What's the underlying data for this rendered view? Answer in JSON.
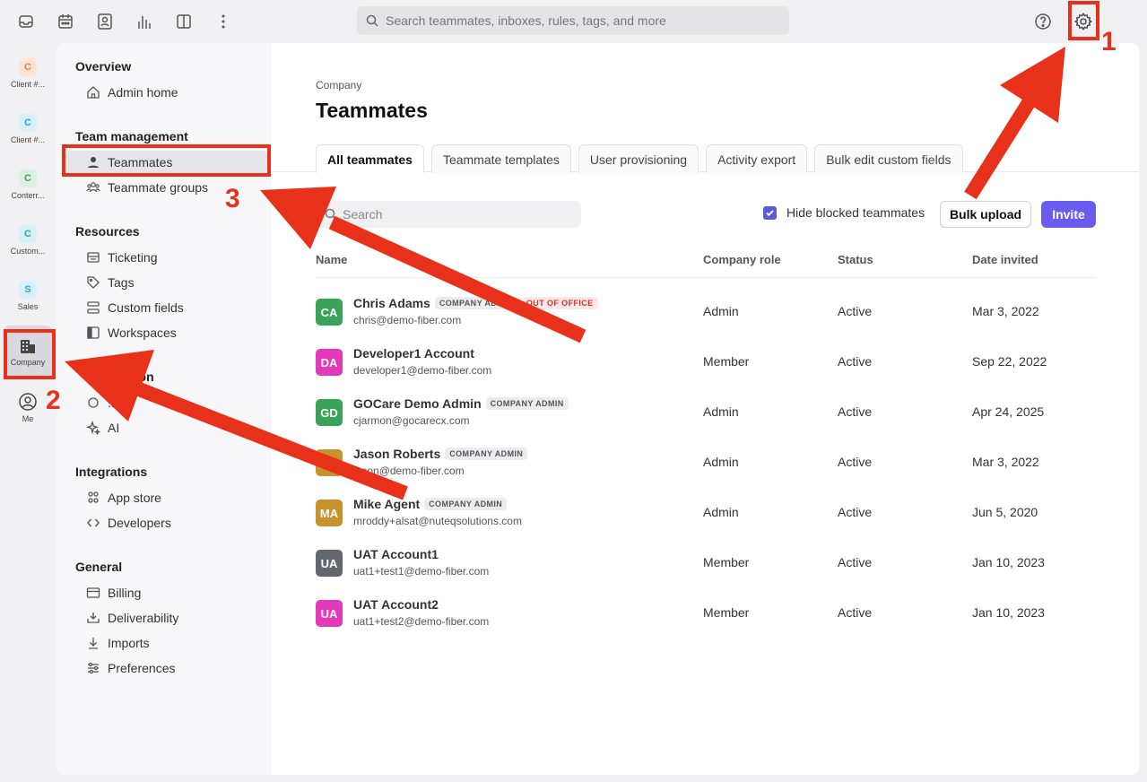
{
  "topbar": {
    "search_placeholder": "Search teammates, inboxes, rules, tags, and more",
    "icons": [
      "inbox-icon",
      "calendar-icon",
      "contacts-icon",
      "analytics-icon",
      "split-view-icon",
      "more-icon",
      "help-icon",
      "settings-gear-icon"
    ]
  },
  "rail": {
    "items": [
      {
        "badge": "C",
        "label": "Client #...",
        "color": "#f07a3a",
        "bg": "#fde5d6"
      },
      {
        "badge": "C",
        "label": "Client #...",
        "color": "#2aa7c9",
        "bg": "#d7f1f8"
      },
      {
        "badge": "C",
        "label": "Conterr...",
        "color": "#3aa35a",
        "bg": "#d9f1de"
      },
      {
        "badge": "C",
        "label": "Custom...",
        "color": "#2aa7c9",
        "bg": "#d7f1f8"
      },
      {
        "badge": "S",
        "label": "Sales",
        "color": "#2aa7c9",
        "bg": "#d7f1f8"
      }
    ],
    "company_label": "Company",
    "me_label": "Me"
  },
  "nav": {
    "overview": {
      "title": "Overview",
      "items": [
        "Admin home"
      ]
    },
    "team": {
      "title": "Team management",
      "items": [
        "Teammates",
        "Teammate groups"
      ]
    },
    "resources": {
      "title": "Resources",
      "items": [
        "Ticketing",
        "Tags",
        "Custom fields",
        "Workspaces"
      ]
    },
    "automation": {
      "title": "...ion",
      "items": [
        "...es",
        "AI"
      ]
    },
    "integrations": {
      "title": "Integrations",
      "items": [
        "App store",
        "Developers"
      ]
    },
    "general": {
      "title": "General",
      "items": [
        "Billing",
        "Deliverability",
        "Imports",
        "Preferences"
      ]
    }
  },
  "main": {
    "breadcrumb": "Company",
    "title": "Teammates",
    "tabs": [
      "All teammates",
      "Teammate templates",
      "User provisioning",
      "Activity export",
      "Bulk edit custom fields"
    ],
    "search_placeholder": "Search",
    "hide_blocked_label": "Hide blocked teammates",
    "bulk_upload_label": "Bulk upload",
    "invite_label": "Invite",
    "columns": [
      "Name",
      "Company role",
      "Status",
      "Date invited"
    ],
    "rows": [
      {
        "initials": "CA",
        "color": "#3aa35a",
        "name": "Chris Adams",
        "chips": [
          "COMPANY ADMIN",
          "OUT OF OFFICE"
        ],
        "email": "chris@demo-fiber.com",
        "role": "Admin",
        "status": "Active",
        "date": "Mar 3, 2022"
      },
      {
        "initials": "DA",
        "color": "#e23ab8",
        "name": "Developer1 Account",
        "chips": [],
        "email": "developer1@demo-fiber.com",
        "role": "Member",
        "status": "Active",
        "date": "Sep 22, 2022"
      },
      {
        "initials": "GD",
        "color": "#3aa35a",
        "name": "GOCare Demo Admin",
        "chips": [
          "COMPANY ADMIN"
        ],
        "email": "cjarmon@gocarecx.com",
        "role": "Admin",
        "status": "Active",
        "date": "Apr 24, 2025"
      },
      {
        "initials": "JR",
        "color": "#c8932e",
        "name": "Jason Roberts",
        "chips": [
          "COMPANY ADMIN"
        ],
        "email": "jason@demo-fiber.com",
        "role": "Admin",
        "status": "Active",
        "date": "Mar 3, 2022"
      },
      {
        "initials": "MA",
        "color": "#c8932e",
        "name": "Mike Agent",
        "chips": [
          "COMPANY ADMIN"
        ],
        "email": "mroddy+alsat@nuteqsolutions.com",
        "role": "Admin",
        "status": "Active",
        "date": "Jun 5, 2020"
      },
      {
        "initials": "UA",
        "color": "#62666f",
        "name": "UAT Account1",
        "chips": [],
        "email": "uat1+test1@demo-fiber.com",
        "role": "Member",
        "status": "Active",
        "date": "Jan 10, 2023"
      },
      {
        "initials": "UA",
        "color": "#e23ab8",
        "name": "UAT Account2",
        "chips": [],
        "email": "uat1+test2@demo-fiber.com",
        "role": "Member",
        "status": "Active",
        "date": "Jan 10, 2023"
      }
    ]
  },
  "annotations": {
    "steps": [
      "1",
      "2",
      "3"
    ],
    "color": "#e8311a"
  }
}
